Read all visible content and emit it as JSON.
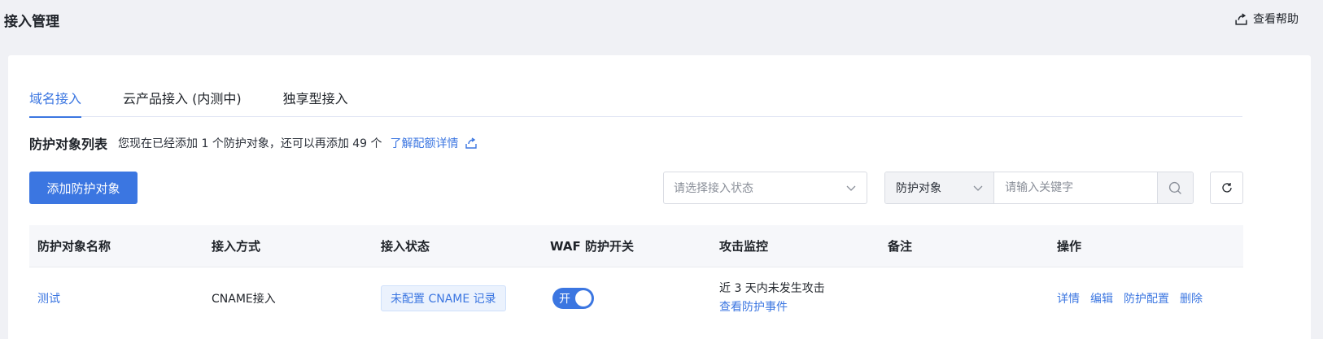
{
  "page": {
    "title": "接入管理",
    "help_label": "查看帮助",
    "help_icon": "external-link-icon"
  },
  "tabs": [
    {
      "label": "域名接入",
      "active": true
    },
    {
      "label": "云产品接入 (内测中)",
      "active": false
    },
    {
      "label": "独享型接入",
      "active": false
    }
  ],
  "list": {
    "title": "防护对象列表",
    "description": "您现在已经添加 1 个防护对象，还可以再添加 49 个",
    "quota_link": "了解配额详情"
  },
  "toolbar": {
    "add_button": "添加防护对象",
    "status_placeholder": "请选择接入状态",
    "search_type": "防护对象",
    "keyword_placeholder": "请输入关键字"
  },
  "table": {
    "headers": [
      "防护对象名称",
      "接入方式",
      "接入状态",
      "WAF 防护开关",
      "攻击监控",
      "备注",
      "操作"
    ],
    "rows": [
      {
        "name": "测试",
        "access_method": "CNAME接入",
        "access_status": "未配置 CNAME 记录",
        "waf_toggle_label": "开",
        "waf_enabled": true,
        "monitor_text": "近 3 天内未发生攻击",
        "monitor_link": "查看防护事件",
        "note": "",
        "actions": [
          "详情",
          "编辑",
          "防护配置",
          "删除"
        ]
      }
    ]
  },
  "colors": {
    "accent": "#3b76e1",
    "background": "#f0f1f5"
  }
}
